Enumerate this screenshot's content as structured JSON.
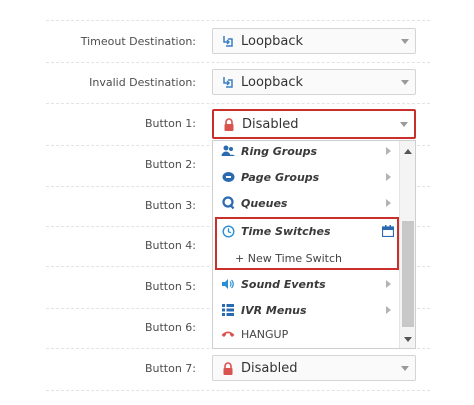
{
  "rows": [
    {
      "label": "Timeout Destination:",
      "value": "Loopback",
      "icon": "loopback-icon"
    },
    {
      "label": "Invalid Destination:",
      "value": "Loopback",
      "icon": "loopback-icon"
    },
    {
      "label": "Button 1:",
      "value": "Disabled",
      "icon": "lock-icon"
    },
    {
      "label": "Button 2:"
    },
    {
      "label": "Button 3:"
    },
    {
      "label": "Button 4:"
    },
    {
      "label": "Button 5:"
    },
    {
      "label": "Button 6:"
    },
    {
      "label": "Button 7:",
      "value": "Disabled",
      "icon": "lock-icon"
    }
  ],
  "dropdown": {
    "items": [
      {
        "label": "Ring Groups",
        "icon": "ring-groups-icon",
        "has_submenu": true
      },
      {
        "label": "Page Groups",
        "icon": "page-groups-icon",
        "has_submenu": true
      },
      {
        "label": "Queues",
        "icon": "queues-icon",
        "has_submenu": true
      },
      {
        "label": "Time Switches",
        "icon": "time-switch-icon",
        "has_submenu": true,
        "expanded": true
      },
      {
        "label": "Sound Events",
        "icon": "sound-events-icon",
        "has_submenu": true
      },
      {
        "label": "IVR Menus",
        "icon": "ivr-menus-icon",
        "has_submenu": true
      },
      {
        "label": "HANGUP",
        "icon": "hangup-icon",
        "has_submenu": false
      }
    ],
    "sub_item": "+ New Time Switch"
  },
  "colors": {
    "highlight": "#c9302c",
    "lock": "#d9534f",
    "loopback": "#3a7fc4",
    "icon_blue": "#2a6ab0",
    "hangup": "#d9534f"
  }
}
